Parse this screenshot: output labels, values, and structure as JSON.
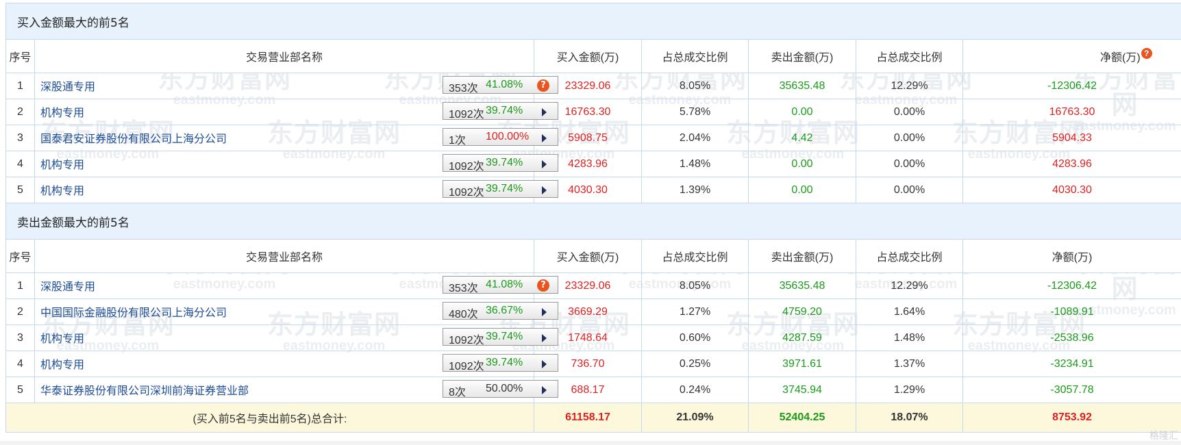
{
  "watermark": {
    "cn": "东方财富网",
    "en": "eastmoney.com"
  },
  "logo_text": "格隆汇",
  "headers": [
    "序号",
    "交易营业部名称",
    "买入金额(万)",
    "占总成交比例",
    "卖出金额(万)",
    "占总成交比例",
    "净额(万)"
  ],
  "buy_section": {
    "title": "买入金额最大的前5名",
    "rows": [
      {
        "idx": "1",
        "name": "深股通专用",
        "count": "353次",
        "pct": "41.08%",
        "pct_color": "green",
        "icon": "question",
        "buy": "23329.06",
        "buy_ratio": "8.05%",
        "sell": "35635.48",
        "sell_ratio": "12.29%",
        "net": "-12306.42",
        "net_color": "green"
      },
      {
        "idx": "2",
        "name": "机构专用",
        "count": "1092次",
        "pct": "39.74%",
        "pct_color": "green",
        "icon": "arrow",
        "buy": "16763.30",
        "buy_ratio": "5.78%",
        "sell": "0.00",
        "sell_ratio": "0.00%",
        "net": "16763.30",
        "net_color": "red"
      },
      {
        "idx": "3",
        "name": "国泰君安证券股份有限公司上海分公司",
        "count": "1次",
        "pct": "100.00%",
        "pct_color": "red",
        "icon": "arrow",
        "buy": "5908.75",
        "buy_ratio": "2.04%",
        "sell": "4.42",
        "sell_ratio": "0.00%",
        "net": "5904.33",
        "net_color": "red"
      },
      {
        "idx": "4",
        "name": "机构专用",
        "count": "1092次",
        "pct": "39.74%",
        "pct_color": "green",
        "icon": "arrow",
        "buy": "4283.96",
        "buy_ratio": "1.48%",
        "sell": "0.00",
        "sell_ratio": "0.00%",
        "net": "4283.96",
        "net_color": "red"
      },
      {
        "idx": "5",
        "name": "机构专用",
        "count": "1092次",
        "pct": "39.74%",
        "pct_color": "green",
        "icon": "arrow",
        "buy": "4030.30",
        "buy_ratio": "1.39%",
        "sell": "0.00",
        "sell_ratio": "0.00%",
        "net": "4030.30",
        "net_color": "red"
      }
    ]
  },
  "sell_section": {
    "title": "卖出金额最大的前5名",
    "rows": [
      {
        "idx": "1",
        "name": "深股通专用",
        "count": "353次",
        "pct": "41.08%",
        "pct_color": "green",
        "icon": "question",
        "buy": "23329.06",
        "buy_ratio": "8.05%",
        "sell": "35635.48",
        "sell_ratio": "12.29%",
        "net": "-12306.42",
        "net_color": "green"
      },
      {
        "idx": "2",
        "name": "中国国际金融股份有限公司上海分公司",
        "count": "480次",
        "pct": "36.67%",
        "pct_color": "green",
        "icon": "arrow",
        "buy": "3669.29",
        "buy_ratio": "1.27%",
        "sell": "4759.20",
        "sell_ratio": "1.64%",
        "net": "-1089.91",
        "net_color": "green"
      },
      {
        "idx": "3",
        "name": "机构专用",
        "count": "1092次",
        "pct": "39.74%",
        "pct_color": "green",
        "icon": "arrow",
        "buy": "1748.64",
        "buy_ratio": "0.60%",
        "sell": "4287.59",
        "sell_ratio": "1.48%",
        "net": "-2538.96",
        "net_color": "green"
      },
      {
        "idx": "4",
        "name": "机构专用",
        "count": "1092次",
        "pct": "39.74%",
        "pct_color": "green",
        "icon": "arrow",
        "buy": "736.70",
        "buy_ratio": "0.25%",
        "sell": "3971.61",
        "sell_ratio": "1.37%",
        "net": "-3234.91",
        "net_color": "green"
      },
      {
        "idx": "5",
        "name": "华泰证券股份有限公司深圳前海证券营业部",
        "count": "8次",
        "pct": "50.00%",
        "pct_color": "dark",
        "icon": "arrow",
        "buy": "688.17",
        "buy_ratio": "0.24%",
        "sell": "3745.94",
        "sell_ratio": "1.29%",
        "net": "-3057.78",
        "net_color": "green"
      }
    ]
  },
  "total": {
    "label": "(买入前5名与卖出前5名)总合计:",
    "buy": "61158.17",
    "buy_ratio": "21.09%",
    "sell": "52404.25",
    "sell_ratio": "18.07%",
    "net": "8753.92"
  },
  "colors": {
    "red": "#e02020",
    "green": "#1a9a1a",
    "link": "#1b4b96",
    "header_bg": "#e8f2fc",
    "total_bg": "#fdf8dc",
    "border": "#c5d9ee"
  }
}
